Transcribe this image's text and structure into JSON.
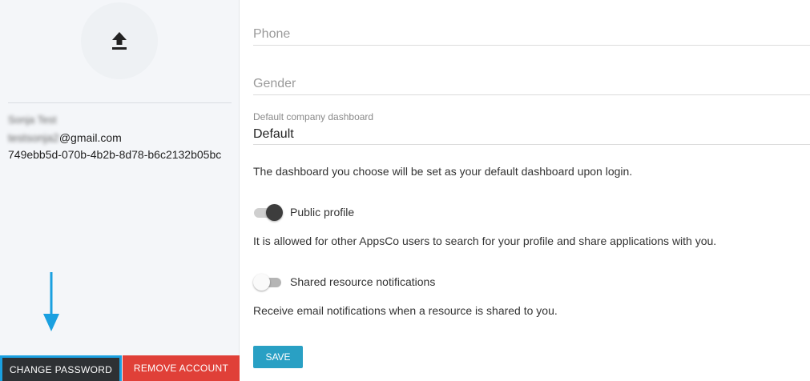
{
  "profile": {
    "name": "Sonja Test",
    "email_local": "testsonja2",
    "email_domain": "@gmail.com",
    "user_id": "749ebb5d-070b-4b2b-8d78-b6c2132b05bc"
  },
  "actions": {
    "change_password_label": "CHANGE PASSWORD",
    "remove_account_label": "REMOVE ACCOUNT"
  },
  "form": {
    "phone_placeholder": "Phone",
    "gender_placeholder": "Gender",
    "dashboard_label": "Default company dashboard",
    "dashboard_value": "Default",
    "dashboard_helper": "The dashboard you choose will be set as your default dashboard upon login.",
    "public_profile": {
      "label": "Public profile",
      "enabled": true,
      "helper": "It is allowed for other AppsCo users to search for your profile and share applications with you."
    },
    "shared_notifications": {
      "label": "Shared resource notifications",
      "enabled": false,
      "helper": "Receive email notifications when a resource is shared to you."
    },
    "save_label": "SAVE"
  },
  "icons": {
    "upload": "upload-icon",
    "annotation": "arrow-down-annotation"
  },
  "colors": {
    "save": "#29a0c4",
    "remove": "#e04038",
    "change_password": "#2e3134",
    "annotation": "#1aa0e0"
  }
}
